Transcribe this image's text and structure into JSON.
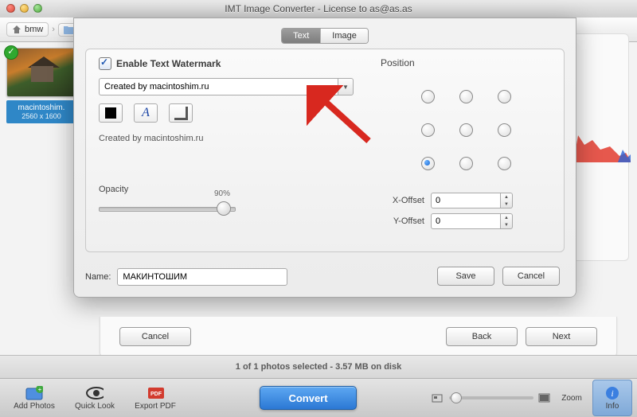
{
  "window": {
    "title": "IMT Image Converter - License to as@as.as"
  },
  "breadcrumb": {
    "root_label": "bmw"
  },
  "thumbnail": {
    "filename": "macintoshim.",
    "dimensions": "2560 x 1600"
  },
  "sheet": {
    "tabs": {
      "text": "Text",
      "image": "Image"
    },
    "enable_label": "Enable Text Watermark",
    "watermark_value": "Created by macintoshim.ru",
    "preview_text": "Created by macintoshim.ru",
    "opacity_label": "Opacity",
    "opacity_value": "90%",
    "position_label": "Position",
    "x_offset_label": "X-Offset",
    "y_offset_label": "Y-Offset",
    "x_offset_value": "0",
    "y_offset_value": "0",
    "name_label": "Name:",
    "name_value": "МАКИНТОШИМ",
    "save": "Save",
    "cancel": "Cancel"
  },
  "panel": {
    "cancel": "Cancel",
    "back": "Back",
    "next": "Next"
  },
  "status": {
    "text": "1 of 1 photos selected - 3.57 MB on disk"
  },
  "bottombar": {
    "add_photos": "Add Photos",
    "quick_look": "Quick Look",
    "export_pdf": "Export PDF",
    "convert": "Convert",
    "zoom": "Zoom",
    "info": "Info"
  }
}
